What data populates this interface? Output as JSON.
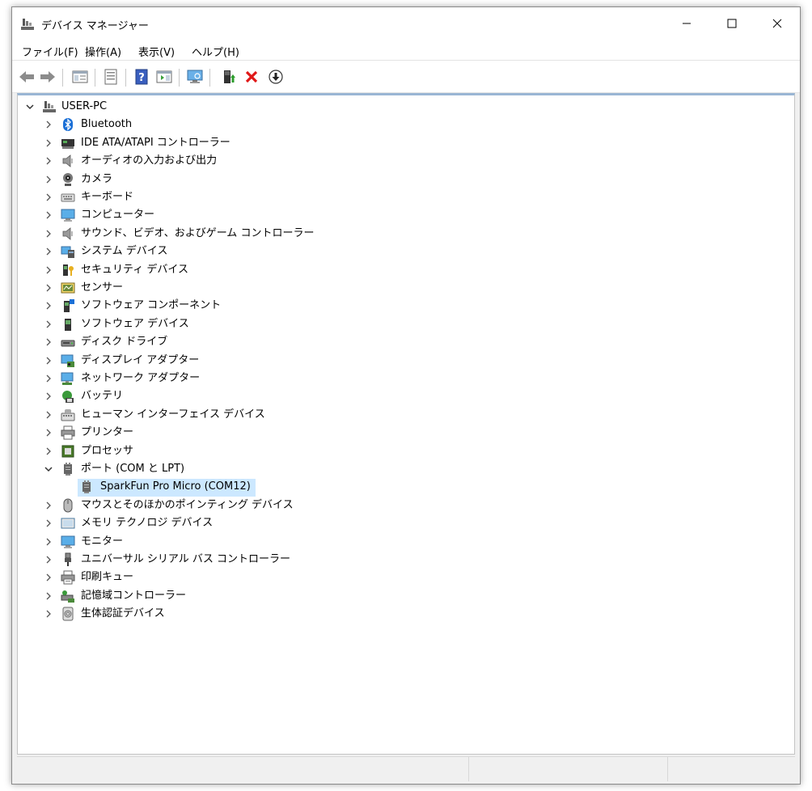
{
  "window": {
    "title": "デバイス マネージャー"
  },
  "menu": [
    "ファイル(F)",
    "操作(A)",
    "表示(V)",
    "ヘルプ(H)"
  ],
  "tree": {
    "root": "USER-PC",
    "categories": [
      "Bluetooth",
      "IDE ATA/ATAPI コントローラー",
      "オーディオの入力および出力",
      "カメラ",
      "キーボード",
      "コンピューター",
      "サウンド、ビデオ、およびゲーム コントローラー",
      "システム デバイス",
      "セキュリティ デバイス",
      "センサー",
      "ソフトウェア コンポーネント",
      "ソフトウェア デバイス",
      "ディスク ドライブ",
      "ディスプレイ アダプター",
      "ネットワーク アダプター",
      "バッテリ",
      "ヒューマン インターフェイス デバイス",
      "プリンター",
      "プロセッサ",
      "ポート (COM と LPT)",
      "マウスとそのほかのポインティング デバイス",
      "メモリ テクノロジ デバイス",
      "モニター",
      "ユニバーサル シリアル バス コントローラー",
      "印刷キュー",
      "記憶域コントローラー",
      "生体認証デバイス"
    ],
    "port_child": "SparkFun Pro Micro (COM12)"
  }
}
